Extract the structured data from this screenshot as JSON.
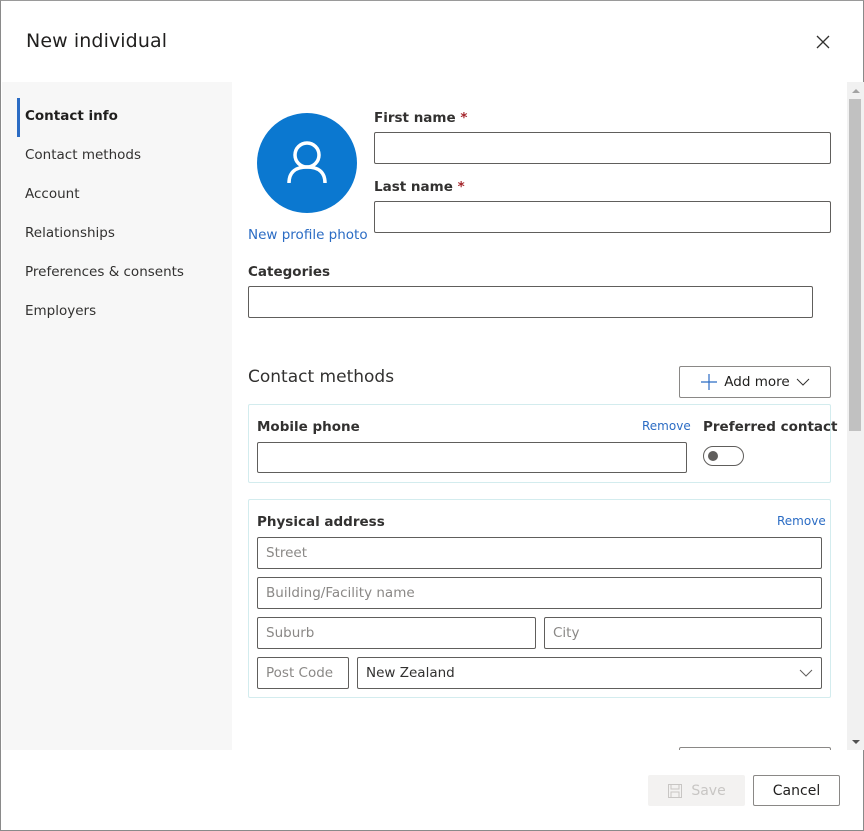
{
  "dialog": {
    "title": "New individual",
    "close_icon": "close-icon"
  },
  "sidebar": {
    "items": [
      {
        "label": "Contact info",
        "active": true
      },
      {
        "label": "Contact methods",
        "active": false
      },
      {
        "label": "Account",
        "active": false
      },
      {
        "label": "Relationships",
        "active": false
      },
      {
        "label": "Preferences & consents",
        "active": false
      },
      {
        "label": "Employers",
        "active": false
      }
    ]
  },
  "contact_info": {
    "avatar_icon": "person-icon",
    "new_photo_link": "New profile photo",
    "first_name": {
      "label": "First name",
      "required_mark": "*",
      "value": ""
    },
    "last_name": {
      "label": "Last name",
      "required_mark": "*",
      "value": ""
    },
    "categories": {
      "label": "Categories",
      "value": ""
    }
  },
  "contact_methods": {
    "title": "Contact methods",
    "add_more_label": "Add more",
    "mobile_phone": {
      "label": "Mobile phone",
      "remove_label": "Remove",
      "value": "",
      "preferred_label": "Preferred contact",
      "preferred": false
    },
    "physical_address": {
      "label": "Physical address",
      "remove_label": "Remove",
      "street_placeholder": "Street",
      "building_placeholder": "Building/Facility name",
      "suburb_placeholder": "Suburb",
      "city_placeholder": "City",
      "postcode_placeholder": "Post Code",
      "country_value": "New Zealand"
    }
  },
  "footer": {
    "save_label": "Save",
    "save_enabled": false,
    "cancel_label": "Cancel"
  },
  "colors": {
    "accent": "#2b6cc4",
    "avatar": "#0b78d0",
    "required": "#a4262c",
    "card_border": "#d3ecee"
  }
}
